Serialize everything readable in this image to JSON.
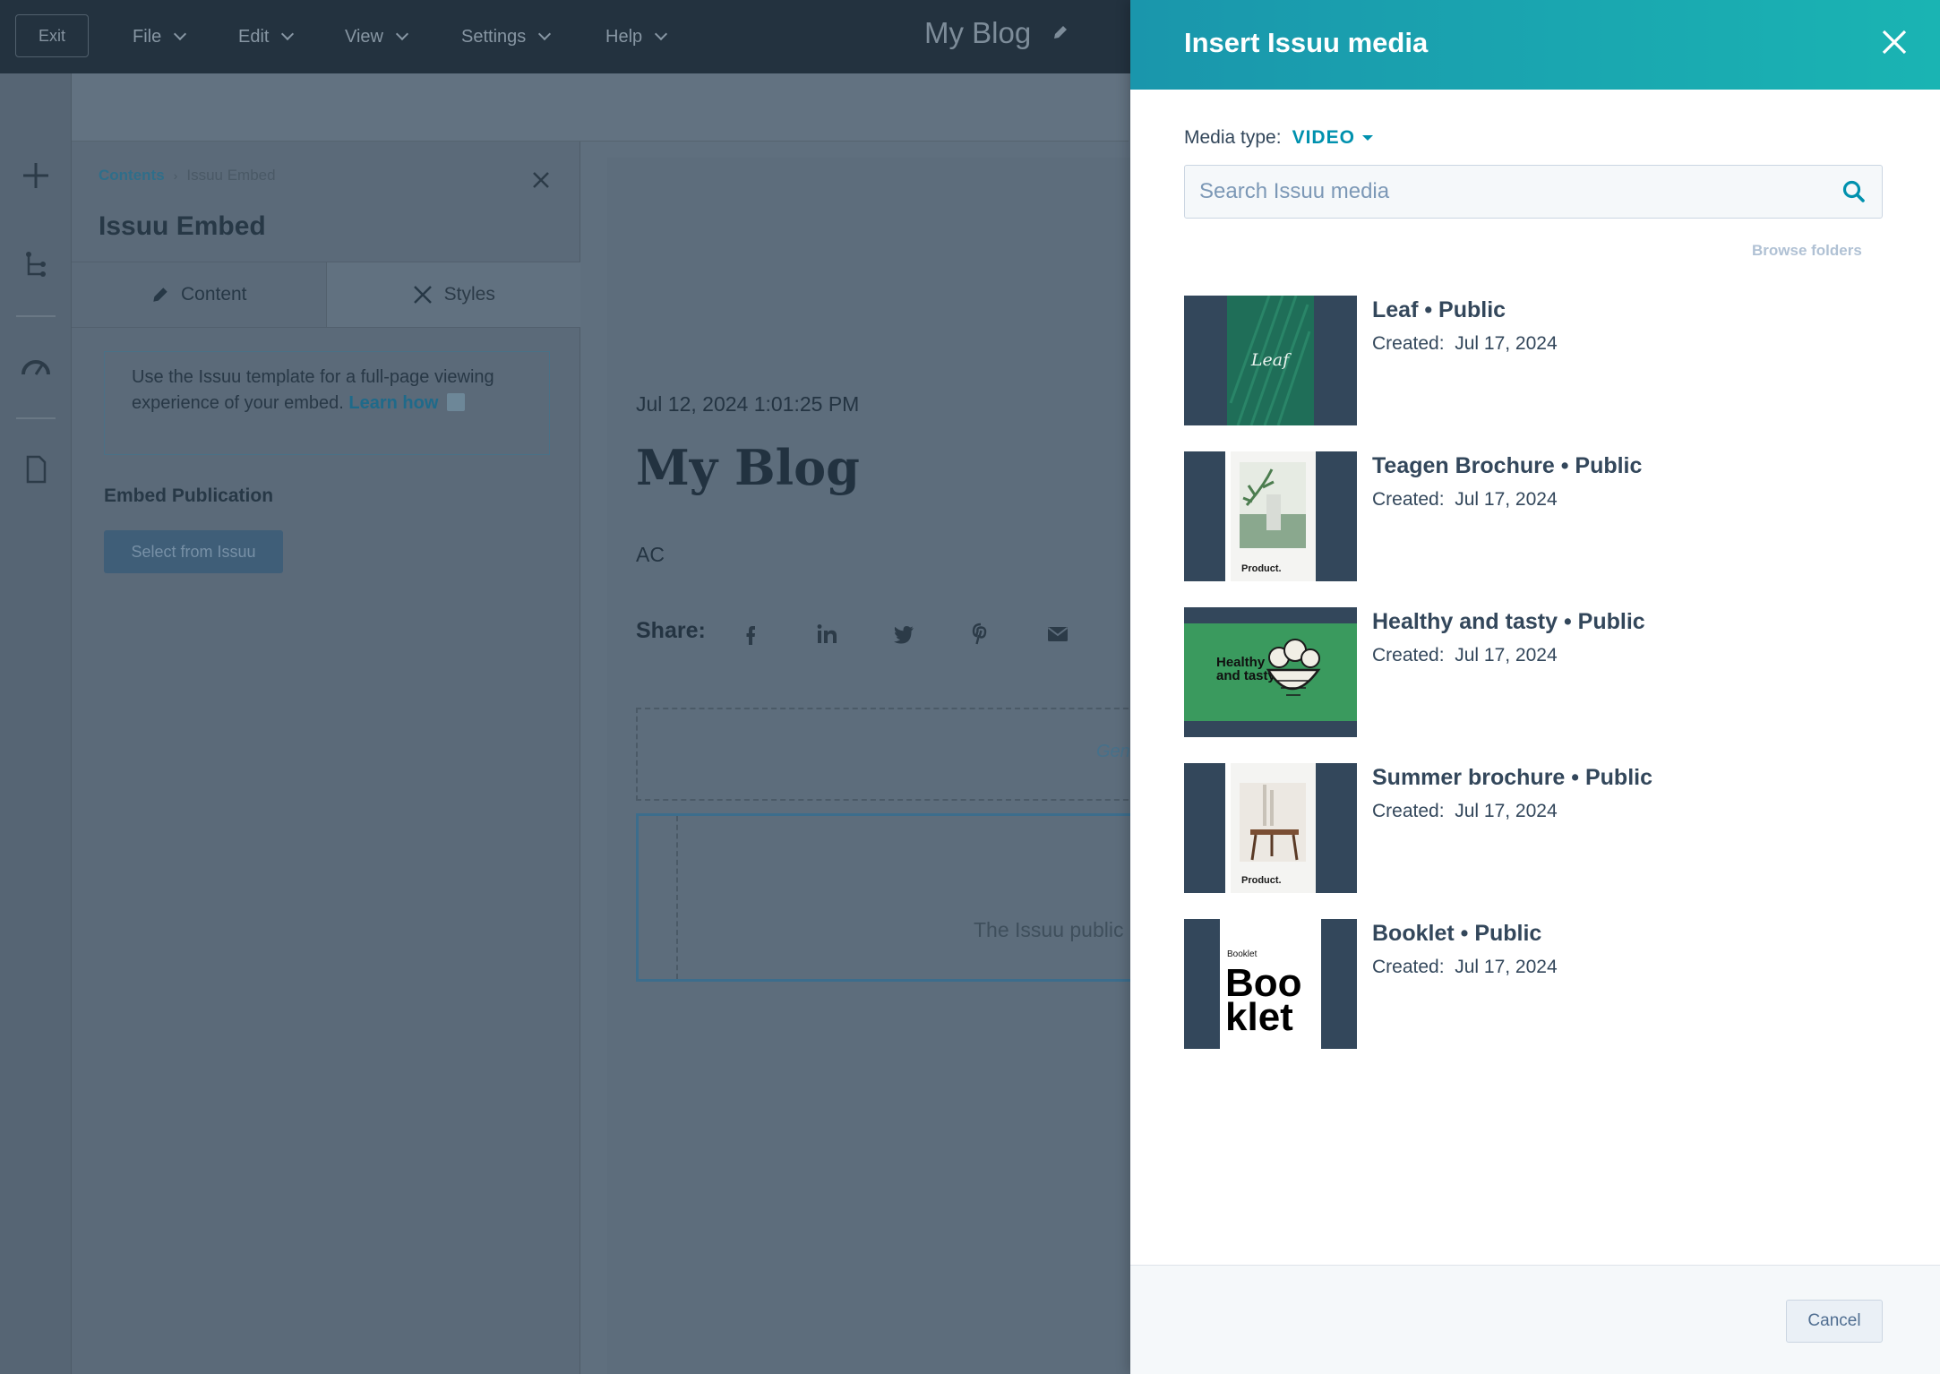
{
  "topbar": {
    "exit_label": "Exit",
    "menus": [
      {
        "label": "File"
      },
      {
        "label": "Edit"
      },
      {
        "label": "View"
      },
      {
        "label": "Settings"
      },
      {
        "label": "Help"
      }
    ],
    "page_title": "My Blog"
  },
  "panel": {
    "breadcrumb": {
      "parent": "Contents",
      "current": "Issuu Embed"
    },
    "title": "Issuu Embed",
    "tabs": [
      {
        "label": "Content",
        "icon": "pencil-icon"
      },
      {
        "label": "Styles",
        "icon": "styles-icon"
      }
    ],
    "info_text": "Use the Issuu template for a full-page viewing experience of your embed.",
    "info_link": "Learn how",
    "embed_label": "Embed Publication",
    "select_button": "Select from Issuu"
  },
  "preview": {
    "date": "Jul 12, 2024 1:01:25 PM",
    "title": "My Blog",
    "author": "AC",
    "share_label": "Share:",
    "gen_text": "Gen",
    "embed_text": "The Issuu public"
  },
  "modal": {
    "title": "Insert Issuu media",
    "media_type_label": "Media type:",
    "media_type_value": "VIDEO",
    "search_placeholder": "Search Issuu media",
    "browse_label": "Browse folders",
    "items": [
      {
        "name": "Leaf • Public",
        "created_label": "Created:",
        "created_date": "Jul 17, 2024"
      },
      {
        "name": "Teagen Brochure • Public",
        "created_label": "Created:",
        "created_date": "Jul 17, 2024"
      },
      {
        "name": "Healthy and tasty • Public",
        "created_label": "Created:",
        "created_date": "Jul 17, 2024"
      },
      {
        "name": "Summer brochure • Public",
        "created_label": "Created:",
        "created_date": "Jul 17, 2024"
      },
      {
        "name": "Booklet • Public",
        "created_label": "Created:",
        "created_date": "Jul 17, 2024"
      }
    ],
    "thumb_text": {
      "leaf": "Leaf",
      "product": "Product.",
      "healthy_line1": "Healthy",
      "healthy_line2": "and tasty",
      "booklet_small": "Booklet",
      "booklet_big1": "Boo",
      "booklet_big2": "klet"
    },
    "cancel_label": "Cancel"
  },
  "colors": {
    "header_start": "#1a96ac",
    "header_end": "#1ab4b3",
    "accent": "#0091ae",
    "text": "#33475b"
  }
}
